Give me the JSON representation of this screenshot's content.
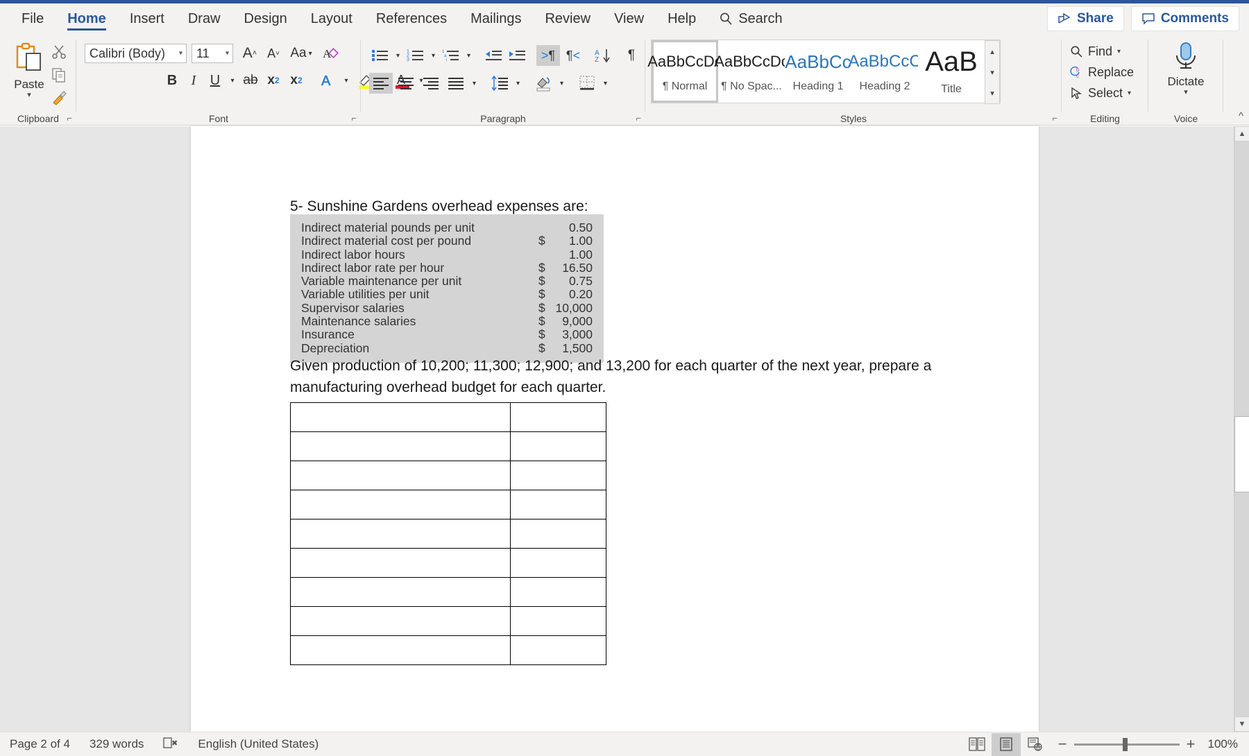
{
  "app": {
    "tabs": [
      {
        "label": "File",
        "active": false
      },
      {
        "label": "Home",
        "active": true
      },
      {
        "label": "Insert",
        "active": false
      },
      {
        "label": "Draw",
        "active": false
      },
      {
        "label": "Design",
        "active": false
      },
      {
        "label": "Layout",
        "active": false
      },
      {
        "label": "References",
        "active": false
      },
      {
        "label": "Mailings",
        "active": false
      },
      {
        "label": "Review",
        "active": false
      },
      {
        "label": "View",
        "active": false
      },
      {
        "label": "Help",
        "active": false
      }
    ],
    "search_label": "Search",
    "share_label": "Share",
    "comments_label": "Comments",
    "accent_color": "#2b579a"
  },
  "ribbon": {
    "groups": [
      "Clipboard",
      "Font",
      "Paragraph",
      "Styles",
      "Editing",
      "Voice"
    ],
    "clipboard": {
      "paste_label": "Paste",
      "cut_tip": "Cut",
      "copy_tip": "Copy",
      "format_painter_tip": "Format Painter"
    },
    "font": {
      "font_name": "Calibri (Body)",
      "font_size": "11",
      "grow_font": "A",
      "shrink_font": "A",
      "change_case": "Aa",
      "clear_formatting": "A",
      "bold": "B",
      "italic": "I",
      "underline": "U",
      "strikethrough": "ab",
      "subscript": "x",
      "superscript": "x",
      "text_effects": "A",
      "highlight": "A",
      "font_color": "A"
    },
    "paragraph": {
      "bullets_tip": "Bullets",
      "numbering_tip": "Numbering",
      "multilevel_tip": "Multilevel List",
      "decrease_indent_tip": "Decrease Indent",
      "increase_indent_tip": "Increase Indent",
      "ltr_tip": "Left-to-Right Text Direction",
      "rtl_tip": "Right-to-Left Text Direction",
      "sort_tip": "Sort",
      "show_marks_tip": "Show/Hide Formatting Marks",
      "align_left_tip": "Align Left",
      "align_center_tip": "Center",
      "align_right_tip": "Align Right",
      "justify_tip": "Justify",
      "line_spacing_tip": "Line and Paragraph Spacing",
      "shading_tip": "Shading",
      "borders_tip": "Borders"
    },
    "styles": {
      "items": [
        {
          "sample": "AaBbCcDc",
          "name": "¶ Normal",
          "selected": true,
          "blue": false
        },
        {
          "sample": "AaBbCcDc",
          "name": "¶ No Spac...",
          "selected": false,
          "blue": false
        },
        {
          "sample": "AaBbCc",
          "name": "Heading 1",
          "selected": false,
          "blue": true
        },
        {
          "sample": "AaBbCcC",
          "name": "Heading 2",
          "selected": false,
          "blue": true
        },
        {
          "sample": "AaB",
          "name": "Title",
          "selected": false,
          "blue": false
        }
      ]
    },
    "editing": {
      "find": "Find",
      "replace": "Replace",
      "select": "Select"
    },
    "voice": {
      "dictate": "Dictate"
    }
  },
  "document": {
    "question_heading": "5- Sunshine Gardens overhead expenses are:",
    "expense_table": [
      {
        "label": "Indirect material pounds per unit",
        "currency": "",
        "value": "0.50"
      },
      {
        "label": "Indirect material cost per pound",
        "currency": "$",
        "value": "1.00"
      },
      {
        "label": "Indirect labor hours",
        "currency": "",
        "value": "1.00"
      },
      {
        "label": "Indirect labor rate per hour",
        "currency": "$",
        "value": "16.50"
      },
      {
        "label": "Variable maintenance per unit",
        "currency": "$",
        "value": "0.75"
      },
      {
        "label": "Variable utilities per unit",
        "currency": "$",
        "value": "0.20"
      },
      {
        "label": "Supervisor salaries",
        "currency": "$",
        "value": "10,000"
      },
      {
        "label": "Maintenance salaries",
        "currency": "$",
        "value": "9,000"
      },
      {
        "label": "Insurance",
        "currency": "$",
        "value": "3,000"
      },
      {
        "label": "Depreciation",
        "currency": "$",
        "value": "1,500"
      }
    ],
    "body_paragraph": "Given production of 10,200; 11,300; 12,900; and 13,200 for each quarter of the next year, prepare a manufacturing overhead budget for each quarter.",
    "answer_table": {
      "rows": 9,
      "cols": 2,
      "cells": [
        [
          "",
          ""
        ],
        [
          "",
          ""
        ],
        [
          "",
          ""
        ],
        [
          "",
          ""
        ],
        [
          "",
          ""
        ],
        [
          "",
          ""
        ],
        [
          "",
          ""
        ],
        [
          "",
          ""
        ],
        [
          "",
          ""
        ]
      ]
    }
  },
  "status": {
    "page": "Page 2 of 4",
    "words": "329 words",
    "proofing_tip": "Proofing errors",
    "language": "English (United States)",
    "view_read": "Read Mode",
    "view_print": "Print Layout",
    "view_web": "Web Layout",
    "zoom_out": "−",
    "zoom_in": "+",
    "zoom_level": "100%"
  }
}
